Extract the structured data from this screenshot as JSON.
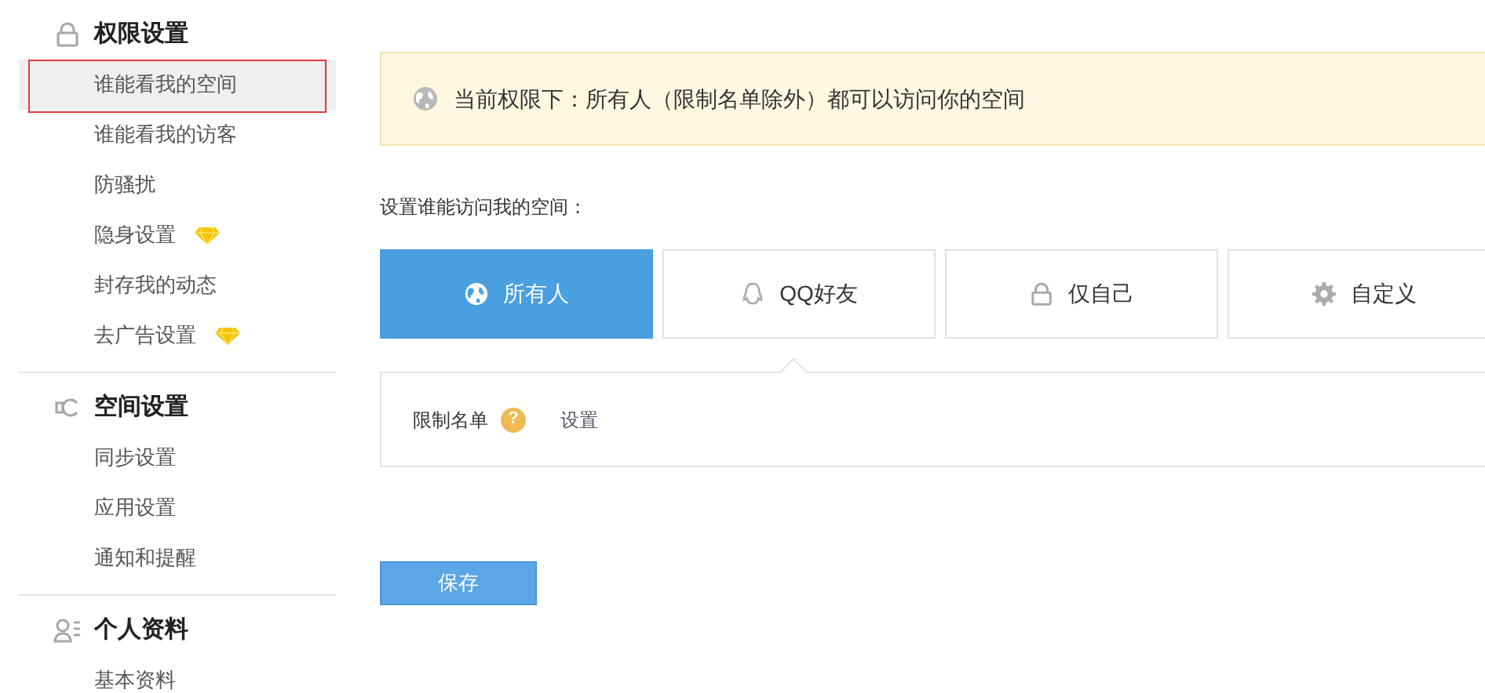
{
  "sidebar": {
    "groups": [
      {
        "kind": "lock",
        "title": "权限设置",
        "items": [
          {
            "label": "谁能看我的空间",
            "selected": true,
            "vip": false
          },
          {
            "label": "谁能看我的访客",
            "selected": false,
            "vip": false
          },
          {
            "label": "防骚扰",
            "selected": false,
            "vip": false
          },
          {
            "label": "隐身设置",
            "selected": false,
            "vip": true
          },
          {
            "label": "封存我的动态",
            "selected": false,
            "vip": false
          },
          {
            "label": "去广告设置",
            "selected": false,
            "vip": true
          }
        ]
      },
      {
        "kind": "plug",
        "title": "空间设置",
        "items": [
          {
            "label": "同步设置",
            "selected": false,
            "vip": false
          },
          {
            "label": "应用设置",
            "selected": false,
            "vip": false
          },
          {
            "label": "通知和提醒",
            "selected": false,
            "vip": false
          }
        ]
      },
      {
        "kind": "profile",
        "title": "个人资料",
        "items": [
          {
            "label": "基本资料",
            "selected": false,
            "vip": false
          }
        ]
      }
    ]
  },
  "notice": "当前权限下：所有人（限制名单除外）都可以访问你的空间",
  "prompt": "设置谁能访问我的空间：",
  "options": [
    {
      "kind": "globe",
      "label": "所有人",
      "selected": true
    },
    {
      "kind": "qq",
      "label": "QQ好友",
      "selected": false
    },
    {
      "kind": "lock",
      "label": "仅自己",
      "selected": false
    },
    {
      "kind": "gear",
      "label": "自定义",
      "selected": false
    }
  ],
  "blocklist": {
    "label": "限制名单",
    "help": "?",
    "link": "设置"
  },
  "save_button": "保存"
}
